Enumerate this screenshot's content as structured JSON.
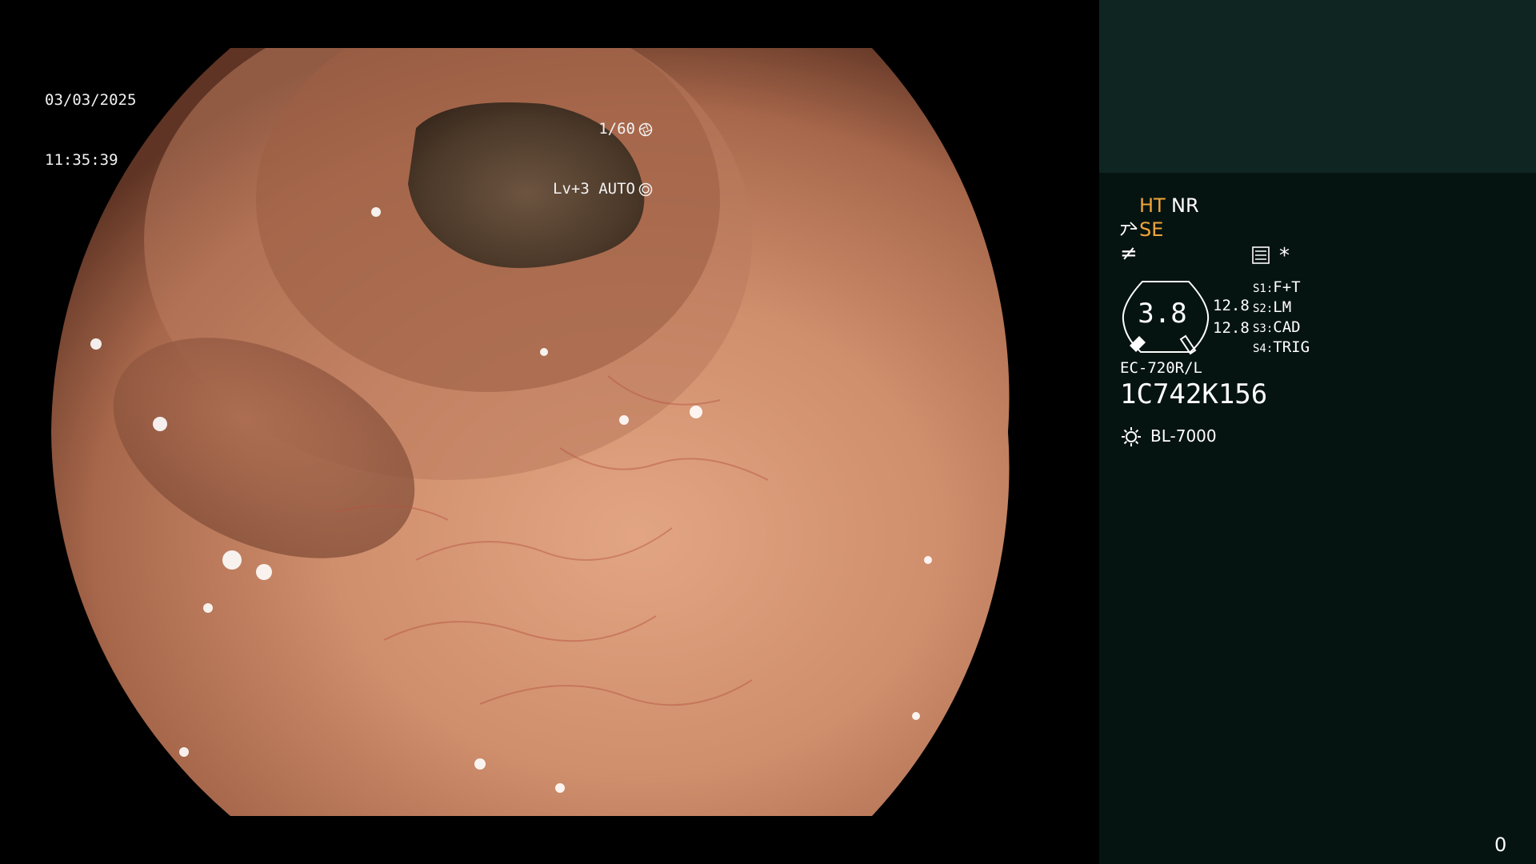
{
  "image": {
    "description_icon": "endoscopic-colon-image"
  },
  "overlay": {
    "date": "03/03/2025",
    "time": "11:35:39",
    "shutter": "1/60",
    "shutter_icon": "aperture-icon",
    "level_mode": "Lv+3 AUTO",
    "mode_icon": "auto-iris-icon"
  },
  "panel": {
    "ht": "HT",
    "nr": "NR",
    "se": "SE",
    "neq": "≠",
    "star": "*",
    "gauge_value": "3.8",
    "gauge_r1": "12.8",
    "gauge_r2": "12.8",
    "switches": [
      {
        "key": "S1:",
        "value": "F+T"
      },
      {
        "key": "S2:",
        "value": "LM"
      },
      {
        "key": "S3:",
        "value": "CAD"
      },
      {
        "key": "S4:",
        "value": "TRIG"
      }
    ],
    "scope_model": "EC-720R/L",
    "scope_serial": "1C742K156",
    "light_source": "BL-7000"
  },
  "counter": "0",
  "colors": {
    "panel_bg": "#061411",
    "panel_top_bg": "#0f2522",
    "accent_orange": "#f0a53a",
    "tissue": "#c9866a"
  }
}
